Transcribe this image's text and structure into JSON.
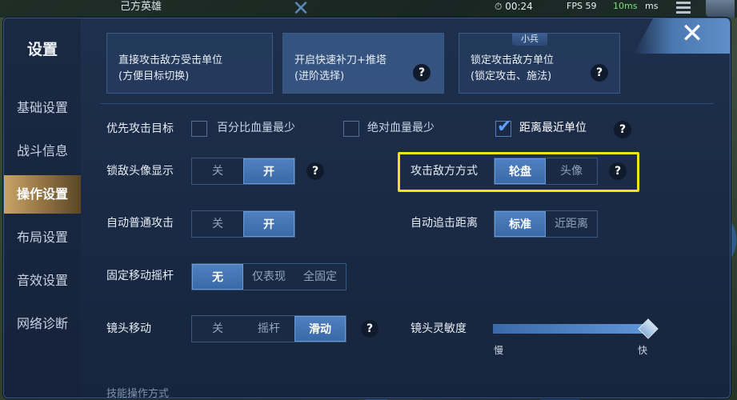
{
  "game_bg": {
    "hero_title": "己方英雄",
    "time": "00:24",
    "fps": "FPS 59",
    "ping": "10ms",
    "ping_unit": "ms"
  },
  "settings": {
    "title": "设置",
    "sidebar": [
      {
        "label": "基础设置",
        "active": false
      },
      {
        "label": "战斗信息",
        "active": false
      },
      {
        "label": "操作设置",
        "active": true
      },
      {
        "label": "布局设置",
        "active": false
      },
      {
        "label": "音效设置",
        "active": false
      },
      {
        "label": "网络诊断",
        "active": false
      }
    ],
    "cards": [
      {
        "line1": "直接攻击敌方受击单位",
        "line2": "(方便目标切换)",
        "tag": ""
      },
      {
        "line1": "开启快速补刀+推塔",
        "line2": "(进阶选择)",
        "tag": ""
      },
      {
        "line1": "锁定攻击敌方单位",
        "line2": "(锁定攻击、施法)",
        "tag": "小兵"
      }
    ],
    "priority_target": {
      "label": "优先攻击目标",
      "options": [
        {
          "label": "百分比血量最少",
          "checked": false
        },
        {
          "label": "绝对血量最少",
          "checked": false
        },
        {
          "label": "距离最近单位",
          "checked": true
        }
      ]
    },
    "lock_avatar": {
      "label": "锁敌头像显示",
      "options": [
        "关",
        "开"
      ],
      "selected": "开"
    },
    "attack_mode": {
      "label": "攻击敌方方式",
      "options": [
        "轮盘",
        "头像"
      ],
      "selected": "轮盘"
    },
    "auto_attack": {
      "label": "自动普通攻击",
      "options": [
        "关",
        "开"
      ],
      "selected": "开"
    },
    "chase_distance": {
      "label": "自动追击距离",
      "options": [
        "标准",
        "近距离"
      ],
      "selected": "标准"
    },
    "fixed_joystick": {
      "label": "固定移动摇杆",
      "options": [
        "无",
        "仅表现",
        "全固定"
      ],
      "selected": "无"
    },
    "camera_move": {
      "label": "镜头移动",
      "options": [
        "关",
        "摇杆",
        "滑动"
      ],
      "selected": "滑动"
    },
    "camera_sensitivity": {
      "label": "镜头灵敏度",
      "min_label": "慢",
      "max_label": "快",
      "value": 1.0
    },
    "bottom_section": "技能操作方式",
    "help_glyph": "?",
    "close_glyph": "✕"
  }
}
